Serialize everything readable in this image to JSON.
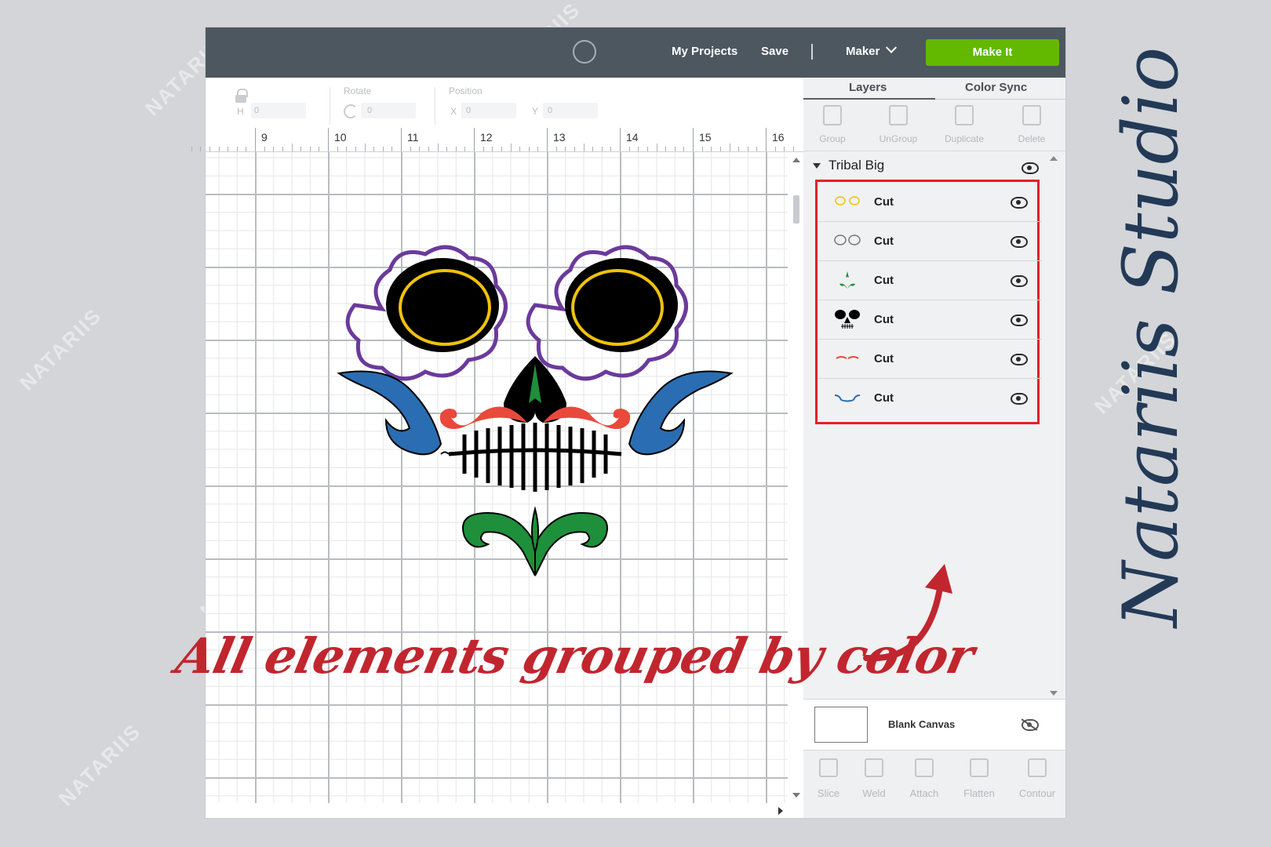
{
  "topbar": {
    "my_projects": "My Projects",
    "save": "Save",
    "maker": "Maker",
    "make_it": "Make It"
  },
  "toolbar": {
    "h_label": "H",
    "rotate_label": "Rotate",
    "position_label": "Position",
    "x_label": "X",
    "y_label": "Y",
    "h_value": "0",
    "rotate_value": "0",
    "x_value": "0",
    "y_value": "0"
  },
  "ruler": [
    "9",
    "10",
    "11",
    "12",
    "13",
    "14",
    "15",
    "16"
  ],
  "panel": {
    "tabs": [
      "Layers",
      "Color Sync"
    ],
    "actions": [
      "Group",
      "UnGroup",
      "Duplicate",
      "Delete"
    ],
    "group_name": "Tribal Big",
    "layers": [
      {
        "label": "Cut",
        "thumb": "yellow-rings"
      },
      {
        "label": "Cut",
        "thumb": "gray-rings"
      },
      {
        "label": "Cut",
        "thumb": "green-leaves"
      },
      {
        "label": "Cut",
        "thumb": "black-skull"
      },
      {
        "label": "Cut",
        "thumb": "red-mustache"
      },
      {
        "label": "Cut",
        "thumb": "blue-tribal"
      }
    ],
    "blank_canvas": "Blank Canvas",
    "bottom_actions": [
      "Slice",
      "Weld",
      "Attach",
      "Flatten",
      "Contour"
    ]
  },
  "headline": "All elements grouped by color",
  "signature": "Natariis Studio",
  "watermark": "NATARIIS",
  "colors": {
    "topbar": "#4d5760",
    "make_it": "#62b900",
    "highlight_box": "#e4202a",
    "headline": "#c1262f",
    "signature": "#233a57"
  }
}
